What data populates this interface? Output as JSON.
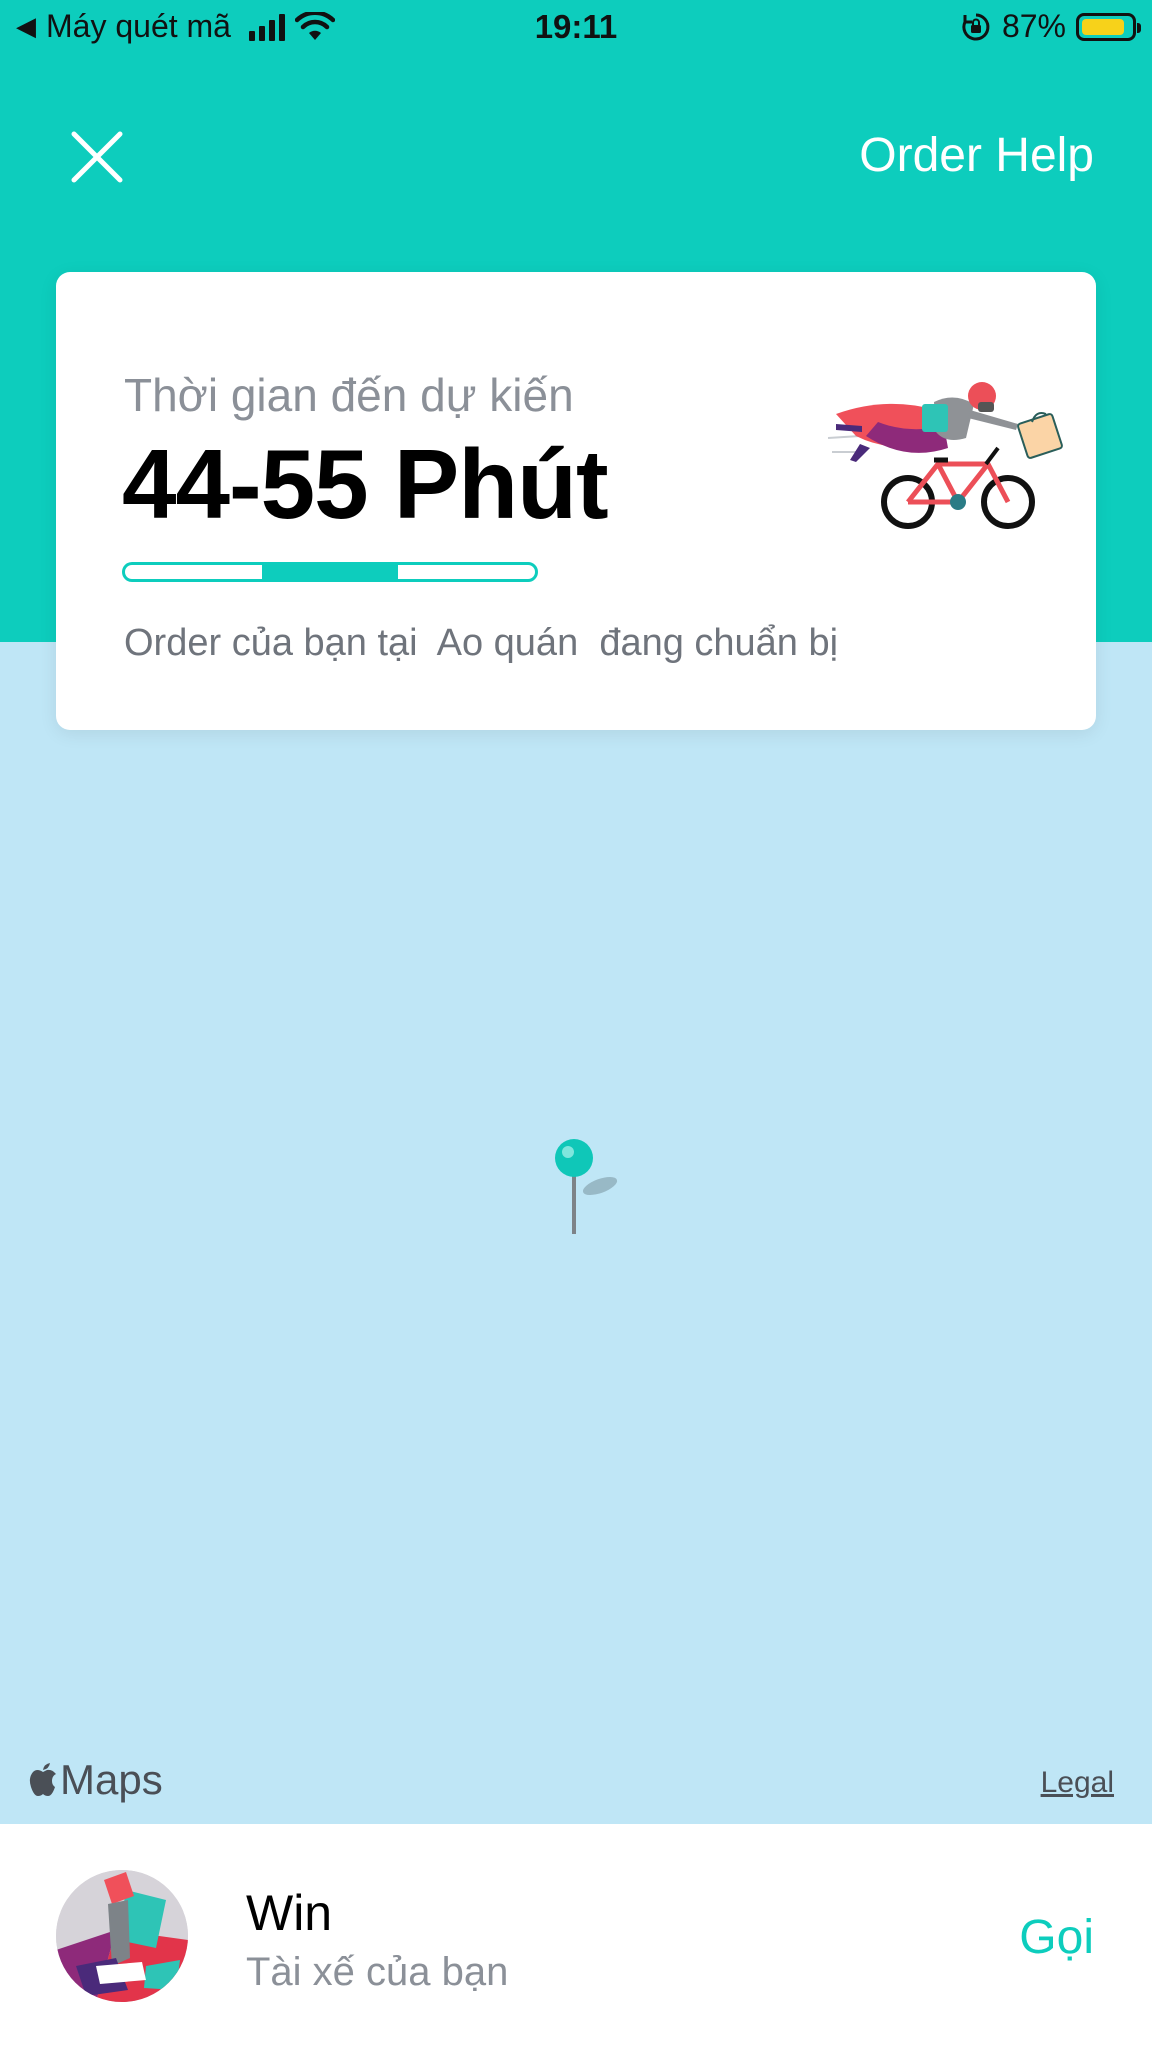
{
  "status_bar": {
    "back_app": "Máy quét mã",
    "time": "19:11",
    "battery": "87%",
    "battery_level": 0.87,
    "battery_color": "#f7d21a"
  },
  "header": {
    "close_icon": "close-icon",
    "order_help": "Order Help"
  },
  "eta_card": {
    "label": "Thời gian đến dự kiến",
    "value": "44-55 Phút",
    "progress": {
      "completed_steps": 1,
      "active_step": 2,
      "total_steps": 3
    },
    "status_message": "Order của bạn tại  Ao quán  đang chuẩn bị",
    "illustration": "courier-on-bicycle-illustration"
  },
  "map": {
    "pin_icon": "map-pin-icon",
    "logo_text": "Maps",
    "logo_icon": "apple-icon",
    "legal": "Legal"
  },
  "driver": {
    "name": "Win",
    "role": "Tài xế của bạn",
    "call_label": "Gọi",
    "avatar_icon": "driver-avatar"
  },
  "colors": {
    "accent": "#0dcdbd",
    "map_water": "#bfe6f6",
    "muted_text": "#8b9098"
  }
}
